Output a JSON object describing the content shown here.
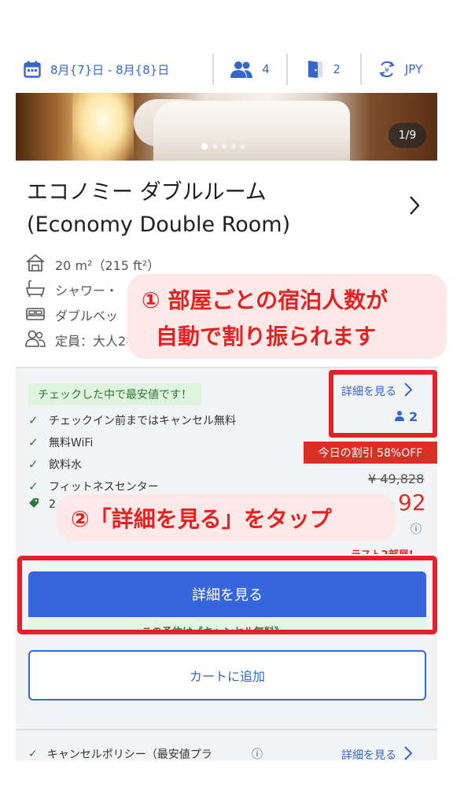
{
  "search_bar": {
    "dates": "8月{7}日 - 8月{8}日",
    "guests": "4",
    "rooms": "2",
    "currency": "JPY",
    "icons": [
      "calendar-icon",
      "people-icon",
      "door-icon",
      "currency-exchange-icon"
    ]
  },
  "gallery": {
    "counter": "1/9",
    "total_images": 9,
    "current_index": 1
  },
  "room": {
    "title_ja": "エコノミー ダブルルーム",
    "title_en": "(Economy Double Room)",
    "specs": [
      {
        "icon": "house-icon",
        "text": "20 m²（215 ft²）"
      },
      {
        "icon": "bathtub-icon",
        "text": "シャワー・"
      },
      {
        "icon": "bed-icon",
        "text": "ダブルベッ"
      },
      {
        "icon": "people-icon",
        "text": "定員：大人2名"
      }
    ]
  },
  "annotations": {
    "callout1_line1": "① 部屋ごとの宿泊人数が",
    "callout1_line2": "自動で割り振られます",
    "callout2": "②「詳細を見る」をタップ"
  },
  "offer": {
    "best_price_badge": "チェックした中で最安値です！",
    "features": [
      "チェックイン前まではキャンセル無料",
      "無料WiFi",
      "飲料水",
      "フィットネスセンター"
    ],
    "partial_feature": "2",
    "details_link": "詳細を見る",
    "occupancy": "2",
    "discount": "今日の割引 58%OFF",
    "original_price": "¥ 49,828",
    "price_visible": "92",
    "info_glyph": "ⓘ",
    "rooms_left": "ラスト2部屋!",
    "details_button": "詳細を見る",
    "cancel_strip": "この予約は《キャンセル無料》",
    "cart_button": "カートに追加"
  },
  "policy": {
    "label": "キャンセルポリシー（最安値プラ",
    "info_glyph": "ⓘ",
    "link": "詳細を見る"
  },
  "colors": {
    "brand_blue": "#3566dd",
    "link_blue": "#3566c9",
    "annotation_red": "#e4202a",
    "discount_red": "#d93025",
    "green": "#2d7a3a"
  }
}
